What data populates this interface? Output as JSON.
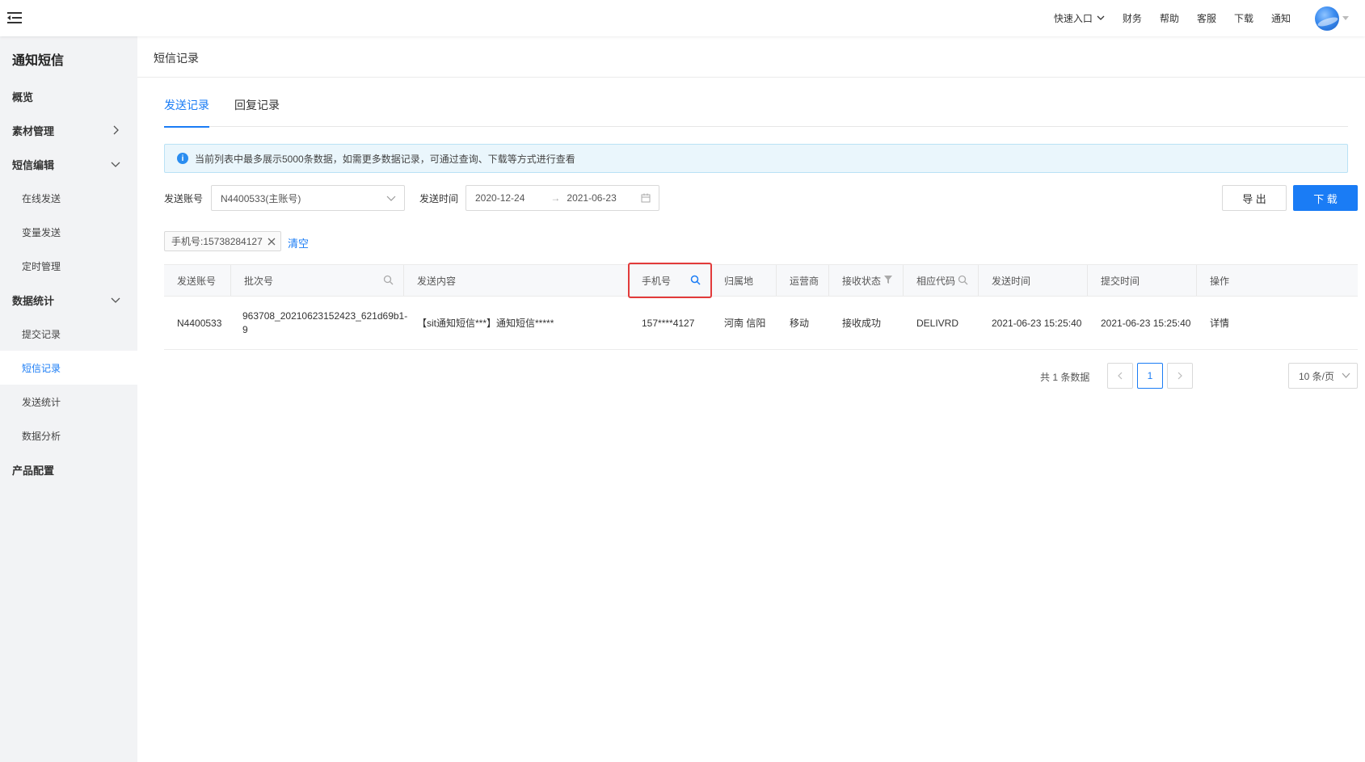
{
  "topbar": {
    "quick_entry": "快速入口",
    "finance": "财务",
    "help": "帮助",
    "service": "客服",
    "download": "下载",
    "notify": "通知",
    "icons": [
      "menu-fold-icon",
      "chevron-down-icon",
      "avatar"
    ]
  },
  "sidebar": {
    "title": "通知短信",
    "items": [
      {
        "label": "概览",
        "level": 1
      },
      {
        "label": "素材管理",
        "level": 1,
        "arrow": "chevron-right"
      },
      {
        "label": "短信编辑",
        "level": 1,
        "arrow": "chevron-down"
      },
      {
        "label": "在线发送",
        "level": 2
      },
      {
        "label": "变量发送",
        "level": 2
      },
      {
        "label": "定时管理",
        "level": 2
      },
      {
        "label": "数据统计",
        "level": 1,
        "arrow": "chevron-down"
      },
      {
        "label": "提交记录",
        "level": 2
      },
      {
        "label": "短信记录",
        "level": 2,
        "active": true
      },
      {
        "label": "发送统计",
        "level": 2
      },
      {
        "label": "数据分析",
        "level": 2
      },
      {
        "label": "产品配置",
        "level": 1
      }
    ]
  },
  "main": {
    "page_title": "短信记录",
    "tabs": [
      {
        "label": "发送记录",
        "active": true
      },
      {
        "label": "回复记录",
        "active": false
      }
    ],
    "notice": "当前列表中最多展示5000条数据，如需更多数据记录，可通过查询、下载等方式进行查看",
    "filters": {
      "account_label": "发送账号",
      "account_value": "N4400533(主账号)",
      "time_label": "发送时间",
      "date_start": "2020-12-24",
      "date_sep": "→",
      "date_end": "2021-06-23"
    },
    "buttons": {
      "export": "导 出",
      "download": "下 载"
    },
    "active_tag": "手机号:15738284127",
    "clear": "清空",
    "table": {
      "columns": [
        "发送账号",
        "批次号",
        "发送内容",
        "手机号",
        "归属地",
        "运营商",
        "接收状态",
        "相应代码",
        "发送时间",
        "提交时间",
        "操作"
      ],
      "rows": [
        {
          "account": "N4400533",
          "batch_line1": "963708_20210623152423_621d69b1-",
          "batch_line2": "9",
          "content": "【sit通知短信***】通知短信*****",
          "phone": "157****4127",
          "location": "河南 信阳",
          "carrier": "移动",
          "status": "接收成功",
          "code": "DELIVRD",
          "send_time": "2021-06-23 15:25:40",
          "submit_time": "2021-06-23 15:25:40",
          "action": "详情"
        }
      ]
    },
    "pagination": {
      "total": "共 1 条数据",
      "current": "1",
      "page_size": "10 条/页"
    }
  },
  "colors": {
    "accent": "#1a7cf5",
    "highlight_box": "#e23b3b",
    "sidebar_bg": "#f2f3f5",
    "notice_bg": "#eaf6fc"
  }
}
